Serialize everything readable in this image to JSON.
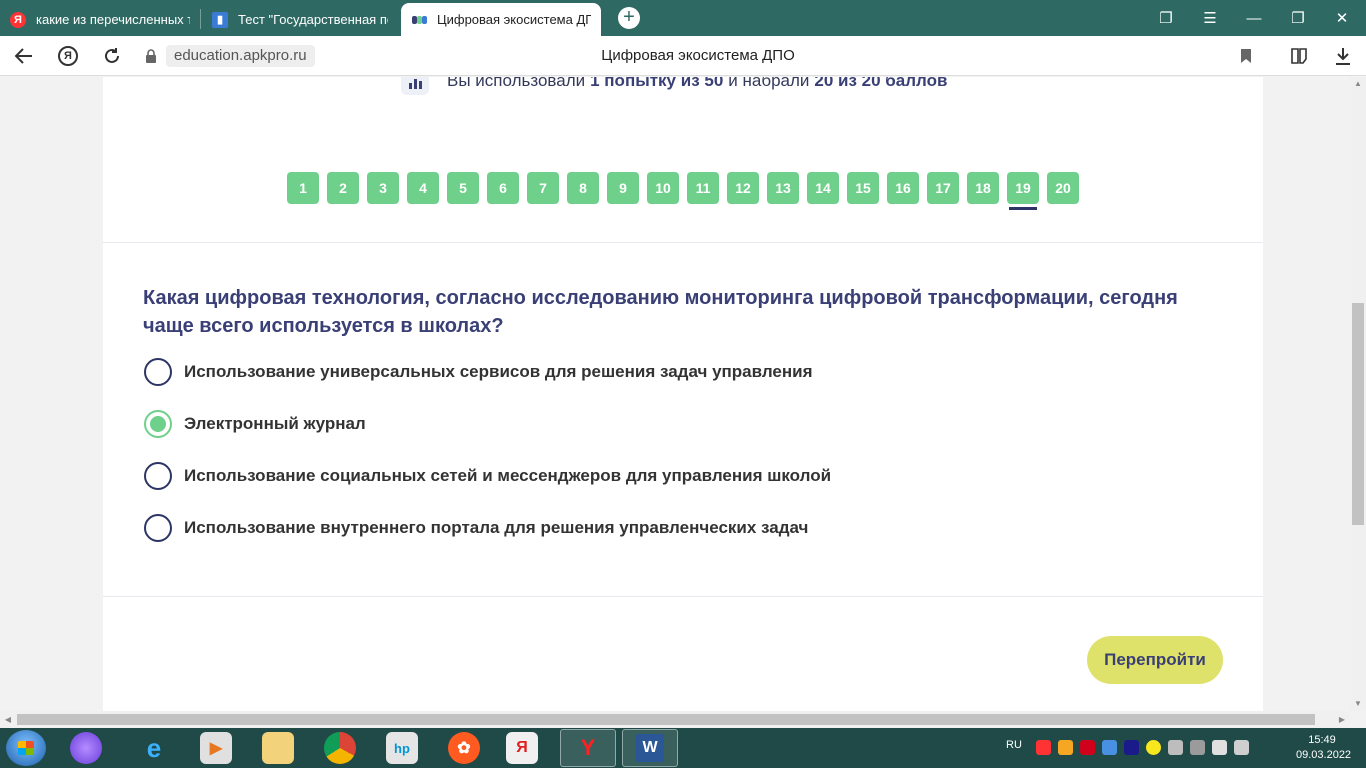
{
  "browser": {
    "tabs": [
      {
        "title": "какие из перечисленных т",
        "favicon": "yandex-icon"
      },
      {
        "title": "Тест \"Государственная пол",
        "favicon": "book-icon"
      },
      {
        "title": "Цифровая экосистема ДПО",
        "favicon": "ecosystem-icon",
        "active": true
      }
    ],
    "address": "education.apkpro.ru",
    "page_title": "Цифровая экосистема ДПО"
  },
  "page": {
    "attempts": {
      "prefix": "Вы использовали",
      "used": "1 попытку из 50",
      "middle": "и набрали",
      "score": "20 из 20 баллов"
    },
    "question_nav": {
      "numbers": [
        "1",
        "2",
        "3",
        "4",
        "5",
        "6",
        "7",
        "8",
        "9",
        "10",
        "11",
        "12",
        "13",
        "14",
        "15",
        "16",
        "17",
        "18",
        "19",
        "20"
      ],
      "current": "19"
    },
    "question": "Какая цифровая технология, согласно исследованию мониторинга цифровой трансформации, сегодня чаще всего используется в школах?",
    "answers": [
      {
        "label": "Использование универсальных сервисов для решения задач управления",
        "selected": false
      },
      {
        "label": "Электронный журнал",
        "selected": true
      },
      {
        "label": "Использование социальных сетей и мессенджеров для управления школой",
        "selected": false
      },
      {
        "label": "Использование внутреннего портала для решения управленческих задач",
        "selected": false
      }
    ],
    "retake_label": "Перепройти"
  },
  "colors": {
    "accent_green": "#6fd08c",
    "navy": "#3a4076",
    "retake_yellow": "#dfe26a",
    "tabbar": "#2e6a63"
  },
  "taskbar": {
    "language": "RU",
    "time": "15:49",
    "date": "09.03.2022"
  }
}
